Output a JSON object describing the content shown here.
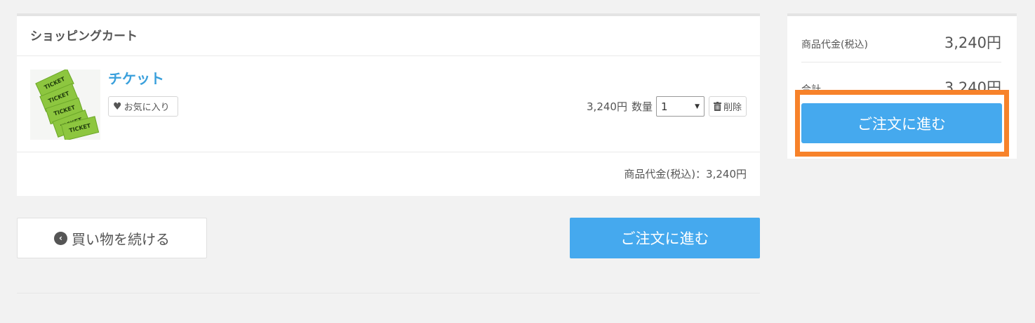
{
  "cart": {
    "title": "ショッピングカート",
    "item": {
      "name": "チケット",
      "thumbnail_text": "TICKET",
      "favorite_label": "お気に入り",
      "price": "3,240円",
      "qty_label": "数量",
      "qty_value": "1",
      "delete_label": "削除"
    },
    "subtotal": "商品代金(税込)：3,240円"
  },
  "actions": {
    "continue_label": "買い物を続ける",
    "order_label": "ご注文に進む"
  },
  "summary": {
    "product_label": "商品代金(税込)",
    "product_value": "3,240円",
    "total_label": "合計",
    "total_value": "3,240円",
    "order_label": "ご注文に進む"
  },
  "colors": {
    "accent": "#45a9ee",
    "link": "#3aa0dc",
    "highlight": "#f7822a"
  }
}
